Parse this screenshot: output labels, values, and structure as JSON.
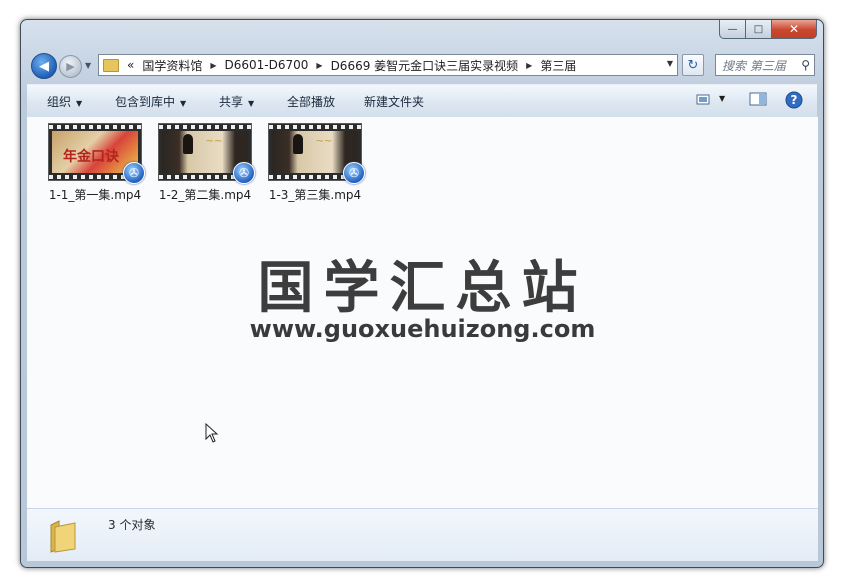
{
  "window": {
    "controls": {
      "minimize": "—",
      "maximize": "□",
      "close": "✕"
    }
  },
  "nav": {
    "back_icon": "◀",
    "forward_icon": "▶",
    "history_icon": "▼",
    "breadcrumb": [
      "«",
      "国学资料馆",
      "D6601-D6700",
      "D6669 姜智元金口诀三届实录视频",
      "第三届"
    ],
    "separator": "▶",
    "dropdown": "▼",
    "refresh_icon": "↻",
    "search_placeholder": "搜索 第三届",
    "search_icon": "⚲"
  },
  "toolbar": {
    "organize": "组织",
    "include_in_library": "包含到库中",
    "share": "共享",
    "play_all": "全部播放",
    "new_folder": "新建文件夹",
    "dropdown_icon": "▼",
    "help_icon": "?"
  },
  "files": [
    {
      "name": "1-1_第一集.mp4",
      "thumb": "title-card",
      "badge_icon": "film-reel-icon"
    },
    {
      "name": "1-2_第二集.mp4",
      "thumb": "lecture",
      "badge_icon": "film-reel-icon"
    },
    {
      "name": "1-3_第三集.mp4",
      "thumb": "lecture",
      "badge_icon": "film-reel-icon"
    }
  ],
  "thumb_text": {
    "card": "年金口诀",
    "gold": "~~"
  },
  "watermark": {
    "title": "国学汇总站",
    "url": "www.guoxuehuizong.com"
  },
  "status": {
    "count_text": "3 个对象"
  },
  "colors": {
    "accent": "#1f5fb8",
    "close": "#c9472f"
  }
}
